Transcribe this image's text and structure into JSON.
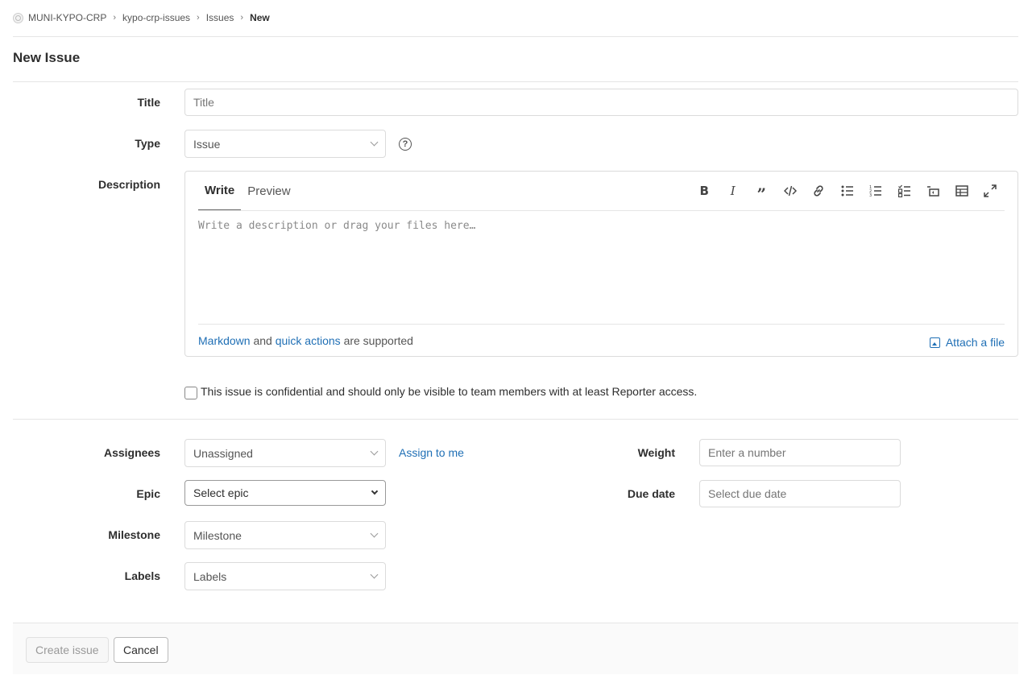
{
  "breadcrumb": {
    "group": "MUNI-KYPO-CRP",
    "project": "kypo-crp-issues",
    "section": "Issues",
    "current": "New"
  },
  "page": {
    "title": "New Issue"
  },
  "form": {
    "title": {
      "label": "Title",
      "placeholder": "Title"
    },
    "type": {
      "label": "Type",
      "value": "Issue"
    },
    "description": {
      "label": "Description",
      "tabs": [
        "Write",
        "Preview"
      ],
      "placeholder": "Write a description or drag your files here…",
      "toolbar_icons": [
        "bold-icon",
        "italic-icon",
        "quote-icon",
        "code-icon",
        "link-icon",
        "bullet-list-icon",
        "numbered-list-icon",
        "task-list-icon",
        "collapsible-icon",
        "table-icon",
        "fullscreen-icon"
      ],
      "footer": {
        "markdown": "Markdown",
        "and": "and",
        "quick_actions": "quick actions",
        "supported": "are supported"
      },
      "attach": "Attach a file"
    },
    "confidential": "This issue is confidential and should only be visible to team members with at least Reporter access.",
    "assignees": {
      "label": "Assignees",
      "value": "Unassigned",
      "assign_me": "Assign to me"
    },
    "epic": {
      "label": "Epic",
      "value": "Select epic"
    },
    "milestone": {
      "label": "Milestone",
      "value": "Milestone"
    },
    "labels": {
      "label": "Labels",
      "value": "Labels"
    },
    "weight": {
      "label": "Weight",
      "placeholder": "Enter a number"
    },
    "due_date": {
      "label": "Due date",
      "placeholder": "Select due date"
    }
  },
  "actions": {
    "create": "Create issue",
    "cancel": "Cancel"
  },
  "colors": {
    "link": "#1f6fb5",
    "border": "#dbdbdb",
    "text": "#2e2e2e"
  }
}
